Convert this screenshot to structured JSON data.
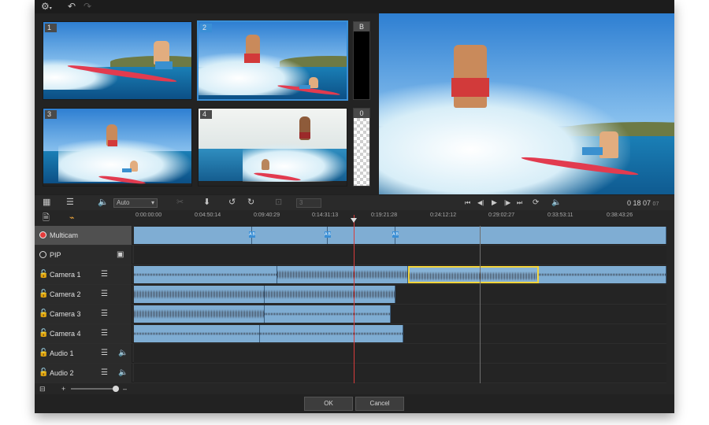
{
  "toolbar": {
    "settings_icon": "gear-icon",
    "undo_icon": "undo-icon",
    "redo_icon": "redo-icon"
  },
  "cameras": [
    {
      "number": "1"
    },
    {
      "number": "2"
    },
    {
      "number": "3"
    },
    {
      "number": "4"
    }
  ],
  "side_slots": [
    {
      "label": "B"
    },
    {
      "label": "0"
    }
  ],
  "controls": {
    "audio_mode": "Auto",
    "number_value": "3",
    "timecode": "0 18 07",
    "timecode_frames": "07"
  },
  "ruler": {
    "ticks": [
      "0:00:00:00",
      "0:04:50:14",
      "0:09:40:29",
      "0:14:31:13",
      "0:19:21:28",
      "0:24:12:12",
      "0:29:02:27",
      "0:33:53:11",
      "0:38:43:26"
    ]
  },
  "tracks": [
    {
      "name": "Multicam"
    },
    {
      "name": "PIP"
    },
    {
      "name": "Camera 1"
    },
    {
      "name": "Camera 2"
    },
    {
      "name": "Camera 3"
    },
    {
      "name": "Camera 4"
    },
    {
      "name": "Audio 1"
    },
    {
      "name": "Audio 2"
    }
  ],
  "markers": {
    "label": "A B"
  },
  "zoom": {
    "plus": "+",
    "minus": "–",
    "level": 0.9
  },
  "buttons": {
    "ok": "OK",
    "cancel": "Cancel"
  },
  "colors": {
    "accent": "#3a8fd6",
    "clip": "#7fadd3",
    "highlight": "#f2d33b",
    "record": "#e43b3b",
    "playhead": "#d83b3b"
  }
}
